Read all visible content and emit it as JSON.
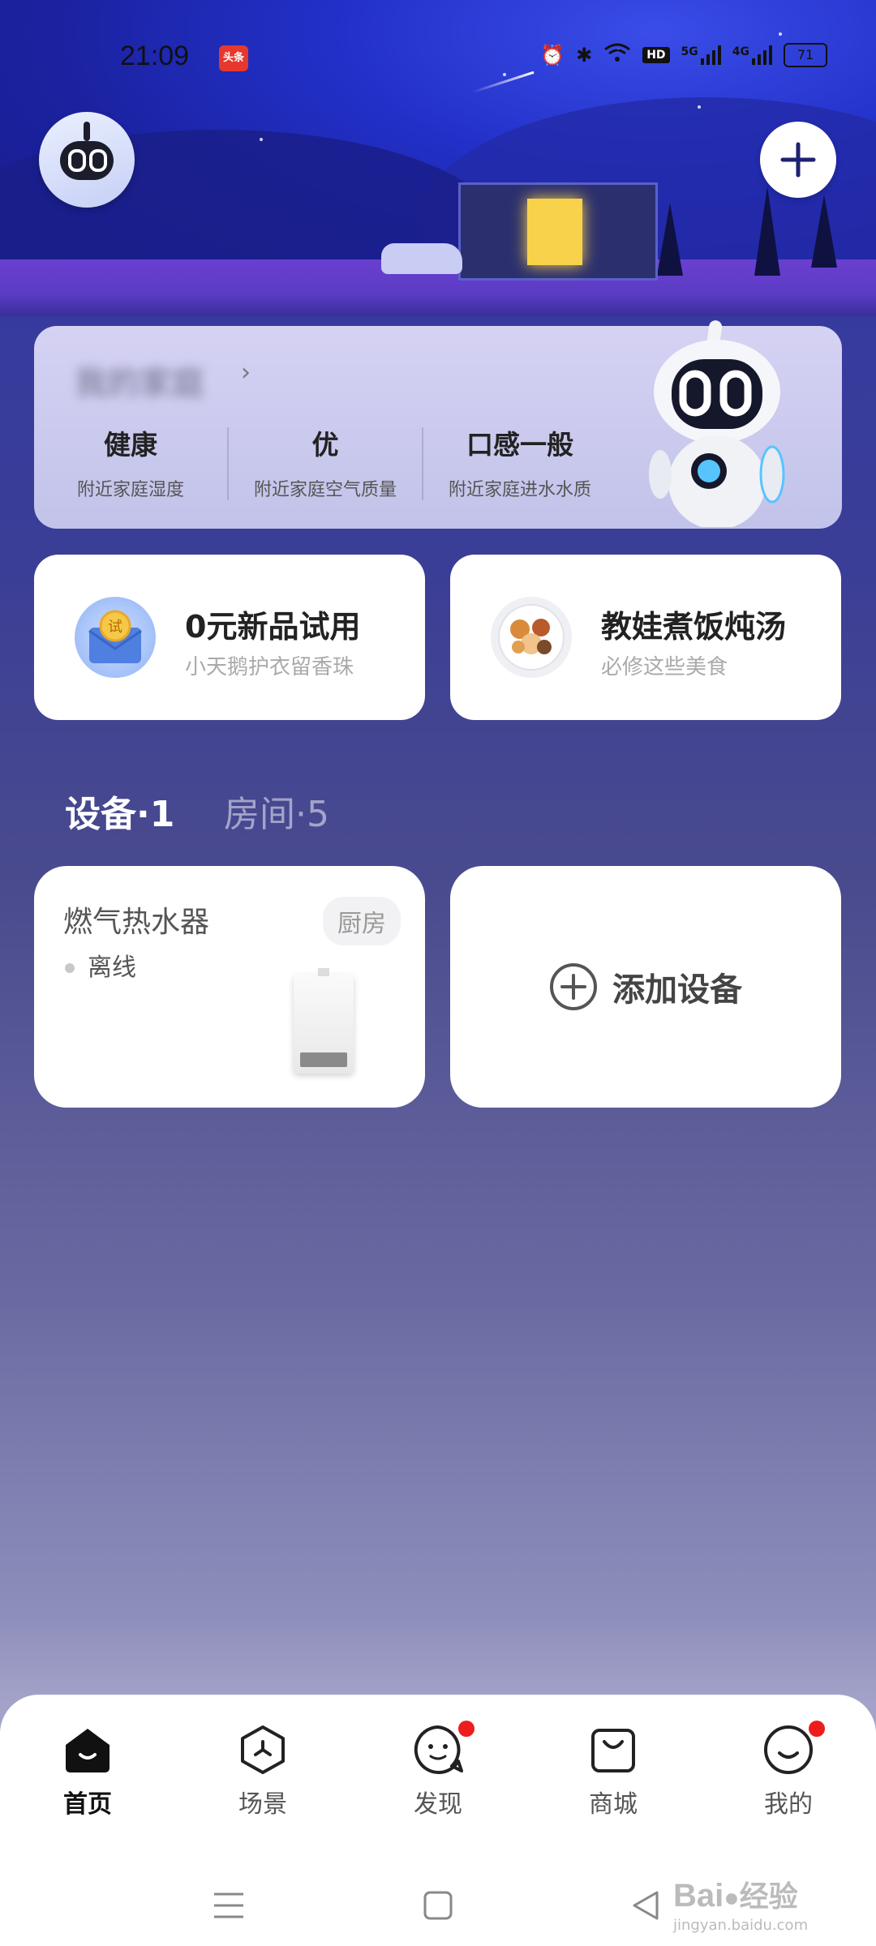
{
  "status_bar": {
    "time": "21:09",
    "news_badge": "头条",
    "battery": "71",
    "network_5g": "5G",
    "network_4g": "4G",
    "hd": "HD"
  },
  "home": {
    "name": "我的家庭",
    "name_arrow": "›"
  },
  "stats": [
    {
      "value": "健康",
      "label": "附近家庭湿度"
    },
    {
      "value": "优",
      "label": "附近家庭空气质量"
    },
    {
      "value": "口感一般",
      "label": "附近家庭进水水质"
    }
  ],
  "promos": [
    {
      "title": "0元新品试用",
      "subtitle": "小天鹅护衣留香珠",
      "icon": "trial-envelope-icon",
      "icon_text": "试"
    },
    {
      "title": "教娃煮饭炖汤",
      "subtitle": "必修这些美食",
      "icon": "food-plate-icon"
    }
  ],
  "tabs": {
    "devices": "设备·1",
    "rooms": "房间·5"
  },
  "devices": [
    {
      "name": "燃气热水器",
      "room": "厨房",
      "status": "离线",
      "icon": "water-heater-icon"
    }
  ],
  "add_device": {
    "label": "添加设备"
  },
  "nav": [
    {
      "label": "首页",
      "active": true,
      "icon": "home-icon"
    },
    {
      "label": "场景",
      "active": false,
      "icon": "scene-icon"
    },
    {
      "label": "发现",
      "active": false,
      "icon": "discover-icon",
      "badge": true
    },
    {
      "label": "商城",
      "active": false,
      "icon": "shop-icon"
    },
    {
      "label": "我的",
      "active": false,
      "icon": "profile-icon",
      "badge": true
    }
  ],
  "watermark": {
    "brand": "Bai",
    "cn": "经验",
    "url": "jingyan.baidu.com"
  },
  "colors": {
    "accent": "#2f36a8",
    "badge_red": "#ee1d1d",
    "window_yellow": "#f8d24a"
  }
}
